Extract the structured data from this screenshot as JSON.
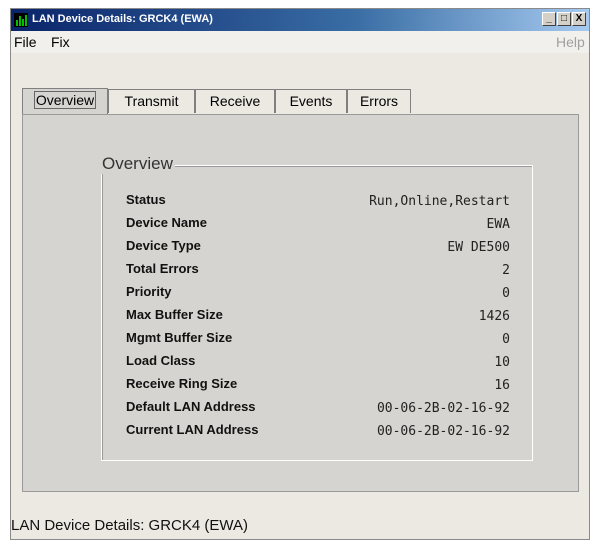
{
  "window": {
    "title": "LAN Device Details: GRCK4  (EWA)",
    "buttons": {
      "minimize": "_",
      "maximize": "□",
      "close": "X"
    }
  },
  "menu": {
    "file": "File",
    "fix": "Fix",
    "help": "Help"
  },
  "tabs": [
    "Overview",
    "Transmit",
    "Receive",
    "Events",
    "Errors"
  ],
  "active_tab": "Overview",
  "overview": {
    "group_title": "Overview",
    "rows": [
      {
        "label": "Status",
        "value": "Run,Online,Restart"
      },
      {
        "label": "Device Name",
        "value": "EWA"
      },
      {
        "label": "Device Type",
        "value": "EW DE500"
      },
      {
        "label": "Total Errors",
        "value": "2"
      },
      {
        "label": "Priority",
        "value": "0"
      },
      {
        "label": "Max Buffer Size",
        "value": "1426"
      },
      {
        "label": "Mgmt Buffer Size",
        "value": "0"
      },
      {
        "label": "Load Class",
        "value": "10"
      },
      {
        "label": "Receive Ring Size",
        "value": "16"
      },
      {
        "label": "Default LAN Address",
        "value": "00-06-2B-02-16-92"
      },
      {
        "label": "Current LAN Address",
        "value": "00-06-2B-02-16-92"
      }
    ]
  },
  "status_bar": "LAN Device Details: GRCK4  (EWA)"
}
